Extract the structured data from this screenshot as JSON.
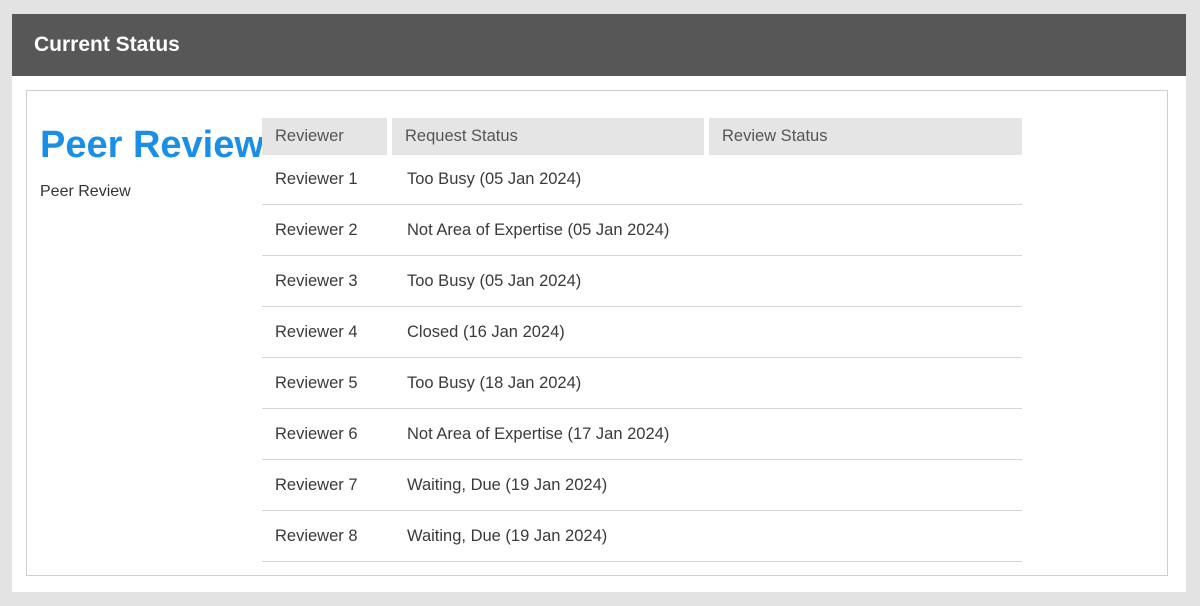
{
  "panel": {
    "title": "Current Status"
  },
  "section": {
    "heading": "Peer Review",
    "subtitle": "Peer Review"
  },
  "table": {
    "headers": [
      "Reviewer",
      "Request Status",
      "Review Status"
    ],
    "rows": [
      {
        "reviewer": "Reviewer 1",
        "request_status": "Too Busy (05 Jan 2024)",
        "review_status": ""
      },
      {
        "reviewer": "Reviewer 2",
        "request_status": "Not Area of Expertise (05 Jan 2024)",
        "review_status": ""
      },
      {
        "reviewer": "Reviewer 3",
        "request_status": "Too Busy (05 Jan 2024)",
        "review_status": ""
      },
      {
        "reviewer": "Reviewer 4",
        "request_status": "Closed (16 Jan 2024)",
        "review_status": ""
      },
      {
        "reviewer": "Reviewer 5",
        "request_status": "Too Busy (18 Jan 2024)",
        "review_status": ""
      },
      {
        "reviewer": "Reviewer 6",
        "request_status": "Not Area of Expertise (17 Jan 2024)",
        "review_status": ""
      },
      {
        "reviewer": "Reviewer 7",
        "request_status": "Waiting, Due (19 Jan 2024)",
        "review_status": ""
      },
      {
        "reviewer": "Reviewer 8",
        "request_status": "Waiting, Due (19 Jan 2024)",
        "review_status": ""
      }
    ]
  },
  "colors": {
    "header_bar": "#575757",
    "heading_accent": "#1a8fe8",
    "table_header_bg": "#e5e5e5",
    "page_bg": "#e3e3e3"
  }
}
